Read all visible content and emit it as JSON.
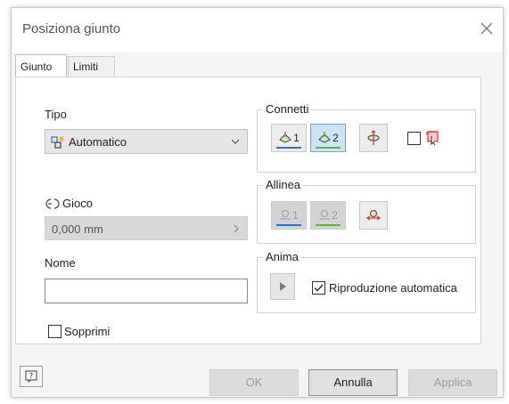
{
  "dialog": {
    "title": "Posiziona giunto"
  },
  "tabs": [
    {
      "label": "Giunto",
      "active": true
    },
    {
      "label": "Limiti",
      "active": false
    }
  ],
  "tipo": {
    "label": "Tipo",
    "value": "Automatico"
  },
  "gioco": {
    "label": "Gioco",
    "value": "0,000 mm"
  },
  "nome": {
    "label": "Nome",
    "value": ""
  },
  "sopprimi": {
    "label": "Sopprimi",
    "checked": false
  },
  "connetti": {
    "label": "Connetti",
    "buttons": [
      {
        "num": "1",
        "pressed": false
      },
      {
        "num": "2",
        "pressed": true
      }
    ]
  },
  "allinea": {
    "label": "Allinea",
    "buttons": [
      {
        "num": "1"
      },
      {
        "num": "2"
      }
    ]
  },
  "anima": {
    "label": "Anima",
    "autoplay_label": "Riproduzione automatica",
    "autoplay_checked": true
  },
  "footer": {
    "ok_label": "OK",
    "cancel_label": "Annulla",
    "apply_label": "Applica"
  },
  "colors": {
    "accent_blue": "#2b73c9",
    "accent_green": "#5fb23b",
    "accent_red": "#d9342b"
  }
}
